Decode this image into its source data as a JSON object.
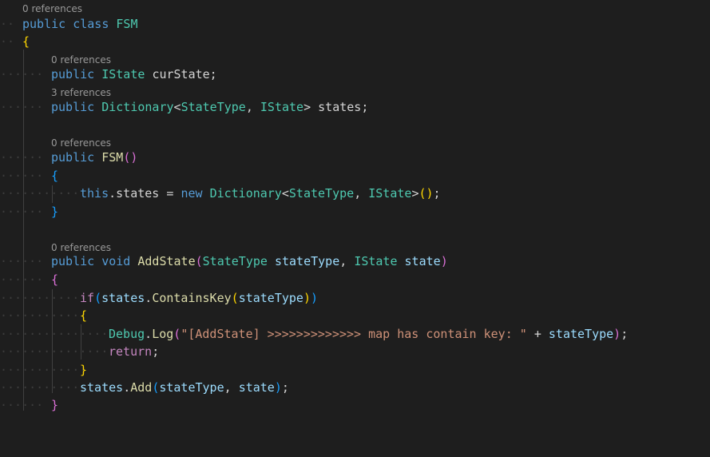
{
  "editor": {
    "background": "#1e1e1e",
    "lens": {
      "class_refs": "0 references",
      "curstate_refs": "0 references",
      "states_refs": "3 references",
      "ctor_refs": "0 references",
      "addstate_refs": "0 references"
    },
    "lines": {
      "l1": {
        "kw1": "public",
        "kw2": "class",
        "name": "FSM"
      },
      "l2": {
        "brace": "{"
      },
      "l3": {
        "kw": "public",
        "type": "IState",
        "name": "curState;"
      },
      "l4": {
        "kw": "public",
        "type": "Dictionary",
        "lt": "<",
        "t1": "StateType",
        "comma": ",",
        "t2": "IState",
        "gt": ">",
        "name": "states;"
      },
      "l5": {
        "kw": "public",
        "name": "FSM",
        "parens": "()"
      },
      "l6": {
        "brace": "{"
      },
      "l7": {
        "this": "this",
        "dot": ".",
        "field": "states",
        "eq": " = ",
        "new": "new",
        "type": "Dictionary",
        "lt": "<",
        "t1": "StateType",
        "comma": ",",
        "t2": "IState",
        "gt": ">",
        "open": "(",
        "close": ")",
        "semi": ";"
      },
      "l8": {
        "brace": "}"
      },
      "l9": {
        "kw1": "public",
        "kw2": "void",
        "name": "AddState",
        "open": "(",
        "t1": "StateType",
        "p1": "stateType",
        "comma": ",",
        "t2": "IState",
        "p2": "state",
        "close": ")"
      },
      "l10": {
        "brace": "{"
      },
      "l11": {
        "if": "if",
        "open": "(",
        "obj": "states",
        "dot": ".",
        "method": "ContainsKey",
        "open2": "(",
        "arg": "stateType",
        "close2": ")",
        "close": ")"
      },
      "l12": {
        "brace": "{"
      },
      "l13": {
        "obj": "Debug",
        "dot": ".",
        "method": "Log",
        "open": "(",
        "str": "\"[AddState] >>>>>>>>>>>>> map has contain key: \"",
        "plus": " + ",
        "arg": "stateType",
        "close": ")",
        "semi": ";"
      },
      "l14": {
        "ret": "return",
        "semi": ";"
      },
      "l15": {
        "brace": "}"
      },
      "l16": {
        "obj": "states",
        "dot": ".",
        "method": "Add",
        "open": "(",
        "a1": "stateType",
        "comma": ", ",
        "a2": "state",
        "close": ")",
        "semi": ";"
      },
      "l17": {
        "brace": "}"
      }
    }
  }
}
